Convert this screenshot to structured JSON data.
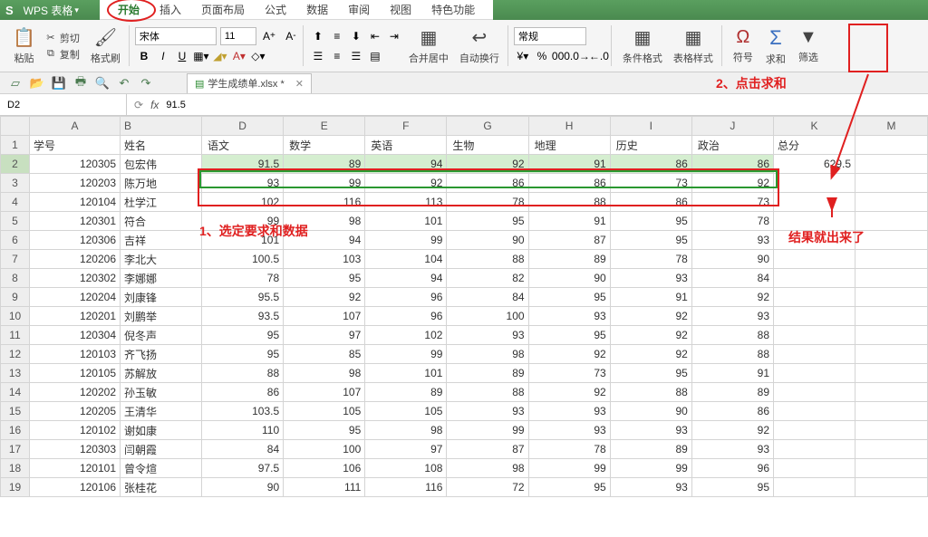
{
  "app": {
    "name": "WPS 表格"
  },
  "menu_tabs": [
    "开始",
    "插入",
    "页面布局",
    "公式",
    "数据",
    "审阅",
    "视图",
    "特色功能"
  ],
  "clipboard": {
    "paste": "粘贴",
    "cut": "剪切",
    "copy": "复制",
    "format_painter": "格式刷"
  },
  "font": {
    "name": "宋体",
    "size": "11"
  },
  "ribbon_right": {
    "merge": "合并居中",
    "wrap": "自动换行",
    "general": "常规",
    "cond_format": "条件格式",
    "table_style": "表格样式",
    "symbol": "符号",
    "sum": "求和",
    "filter": "筛选"
  },
  "doc_tab": "学生成绩单.xlsx *",
  "name_box": "D2",
  "formula": "91.5",
  "columns": [
    "A",
    "B",
    "D",
    "E",
    "F",
    "G",
    "H",
    "I",
    "J",
    "K",
    "M"
  ],
  "headers": {
    "id": "学号",
    "name": "姓名",
    "chinese": "语文",
    "math": "数学",
    "english": "英语",
    "biology": "生物",
    "geography": "地理",
    "history": "历史",
    "politics": "政治",
    "total": "总分"
  },
  "rows": [
    {
      "n": 1
    },
    {
      "n": 2,
      "id": "120305",
      "name": "包宏伟",
      "d": "91.5",
      "e": "89",
      "f": "94",
      "g": "92",
      "h": "91",
      "i": "86",
      "j": "86",
      "k": "629.5"
    },
    {
      "n": 3,
      "id": "120203",
      "name": "陈万地",
      "d": "93",
      "e": "99",
      "f": "92",
      "g": "86",
      "h": "86",
      "i": "73",
      "j": "92",
      "k": ""
    },
    {
      "n": 4,
      "id": "120104",
      "name": "杜学江",
      "d": "102",
      "e": "116",
      "f": "113",
      "g": "78",
      "h": "88",
      "i": "86",
      "j": "73",
      "k": ""
    },
    {
      "n": 5,
      "id": "120301",
      "name": "符合",
      "d": "99",
      "e": "98",
      "f": "101",
      "g": "95",
      "h": "91",
      "i": "95",
      "j": "78",
      "k": ""
    },
    {
      "n": 6,
      "id": "120306",
      "name": "吉祥",
      "d": "101",
      "e": "94",
      "f": "99",
      "g": "90",
      "h": "87",
      "i": "95",
      "j": "93",
      "k": ""
    },
    {
      "n": 7,
      "id": "120206",
      "name": "李北大",
      "d": "100.5",
      "e": "103",
      "f": "104",
      "g": "88",
      "h": "89",
      "i": "78",
      "j": "90",
      "k": ""
    },
    {
      "n": 8,
      "id": "120302",
      "name": "李娜娜",
      "d": "78",
      "e": "95",
      "f": "94",
      "g": "82",
      "h": "90",
      "i": "93",
      "j": "84",
      "k": ""
    },
    {
      "n": 9,
      "id": "120204",
      "name": "刘康锋",
      "d": "95.5",
      "e": "92",
      "f": "96",
      "g": "84",
      "h": "95",
      "i": "91",
      "j": "92",
      "k": ""
    },
    {
      "n": 10,
      "id": "120201",
      "name": "刘鹏举",
      "d": "93.5",
      "e": "107",
      "f": "96",
      "g": "100",
      "h": "93",
      "i": "92",
      "j": "93",
      "k": ""
    },
    {
      "n": 11,
      "id": "120304",
      "name": "倪冬声",
      "d": "95",
      "e": "97",
      "f": "102",
      "g": "93",
      "h": "95",
      "i": "92",
      "j": "88",
      "k": ""
    },
    {
      "n": 12,
      "id": "120103",
      "name": "齐飞扬",
      "d": "95",
      "e": "85",
      "f": "99",
      "g": "98",
      "h": "92",
      "i": "92",
      "j": "88",
      "k": ""
    },
    {
      "n": 13,
      "id": "120105",
      "name": "苏解放",
      "d": "88",
      "e": "98",
      "f": "101",
      "g": "89",
      "h": "73",
      "i": "95",
      "j": "91",
      "k": ""
    },
    {
      "n": 14,
      "id": "120202",
      "name": "孙玉敏",
      "d": "86",
      "e": "107",
      "f": "89",
      "g": "88",
      "h": "92",
      "i": "88",
      "j": "89",
      "k": ""
    },
    {
      "n": 15,
      "id": "120205",
      "name": "王清华",
      "d": "103.5",
      "e": "105",
      "f": "105",
      "g": "93",
      "h": "93",
      "i": "90",
      "j": "86",
      "k": ""
    },
    {
      "n": 16,
      "id": "120102",
      "name": "谢如康",
      "d": "110",
      "e": "95",
      "f": "98",
      "g": "99",
      "h": "93",
      "i": "93",
      "j": "92",
      "k": ""
    },
    {
      "n": 17,
      "id": "120303",
      "name": "闫朝霞",
      "d": "84",
      "e": "100",
      "f": "97",
      "g": "87",
      "h": "78",
      "i": "89",
      "j": "93",
      "k": ""
    },
    {
      "n": 18,
      "id": "120101",
      "name": "曾令煊",
      "d": "97.5",
      "e": "106",
      "f": "108",
      "g": "98",
      "h": "99",
      "i": "99",
      "j": "96",
      "k": ""
    },
    {
      "n": 19,
      "id": "120106",
      "name": "张桂花",
      "d": "90",
      "e": "111",
      "f": "116",
      "g": "72",
      "h": "95",
      "i": "93",
      "j": "95",
      "k": ""
    }
  ],
  "annotations": {
    "a1": "1、选定要求和数据",
    "a2": "2、点击求和",
    "a3": "结果就出来了"
  }
}
